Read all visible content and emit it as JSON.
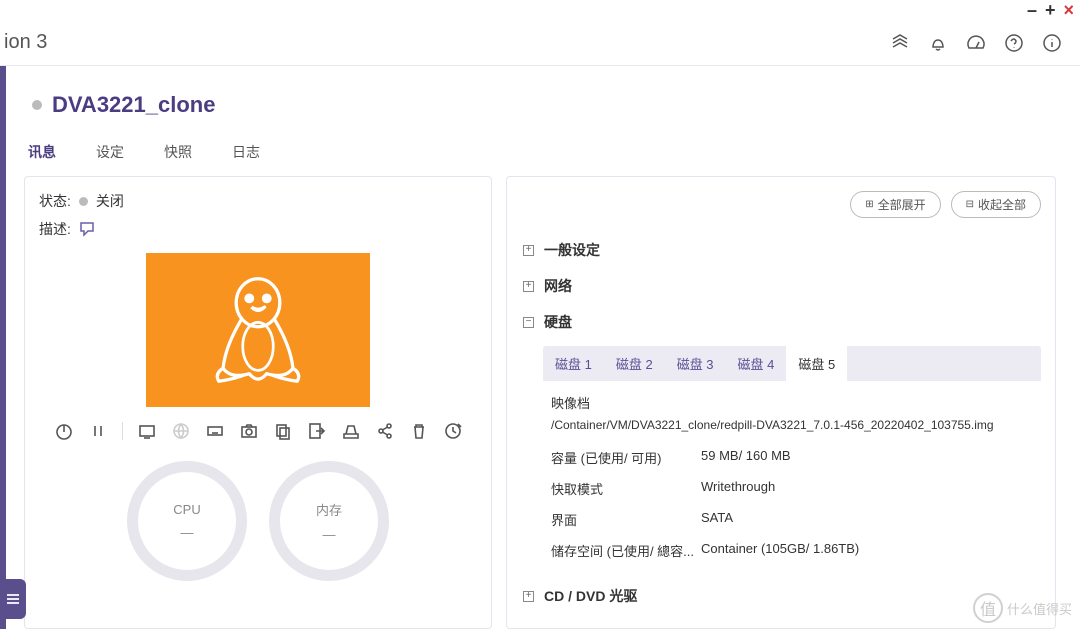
{
  "window": {
    "title_fragment": "ion 3"
  },
  "vm": {
    "name": "DVA3221_clone"
  },
  "tabs": {
    "info": "讯息",
    "settings": "设定",
    "snapshot": "快照",
    "log": "日志"
  },
  "left_panel": {
    "status_label": "状态:",
    "status_value": "关闭",
    "desc_label": "描述:",
    "gauges": {
      "cpu": {
        "label": "CPU",
        "value": "—"
      },
      "mem": {
        "label": "内存",
        "value": "—"
      }
    }
  },
  "right_panel": {
    "expand_all": "全部展开",
    "collapse_all": "收起全部",
    "sections": {
      "general": "一般设定",
      "network": "网络",
      "disk": "硬盘",
      "cddvd": "CD / DVD 光驱"
    },
    "disk_tabs": {
      "d1": "磁盘 1",
      "d2": "磁盘 2",
      "d3": "磁盘 3",
      "d4": "磁盘 4",
      "d5": "磁盘 5"
    },
    "disk_details": {
      "image_label": "映像档",
      "image_path": "/Container/VM/DVA3221_clone/redpill-DVA3221_7.0.1-456_20220402_103755.img",
      "capacity_label": "容量 (已使用/ 可用)",
      "capacity_value": "59 MB/ 160 MB",
      "cache_label": "快取模式",
      "cache_value": "Writethrough",
      "interface_label": "界面",
      "interface_value": "SATA",
      "storage_label": "储存空间 (已使用/ 總容...",
      "storage_value": "Container (105GB/ 1.86TB)"
    }
  },
  "watermark": "什么值得买"
}
